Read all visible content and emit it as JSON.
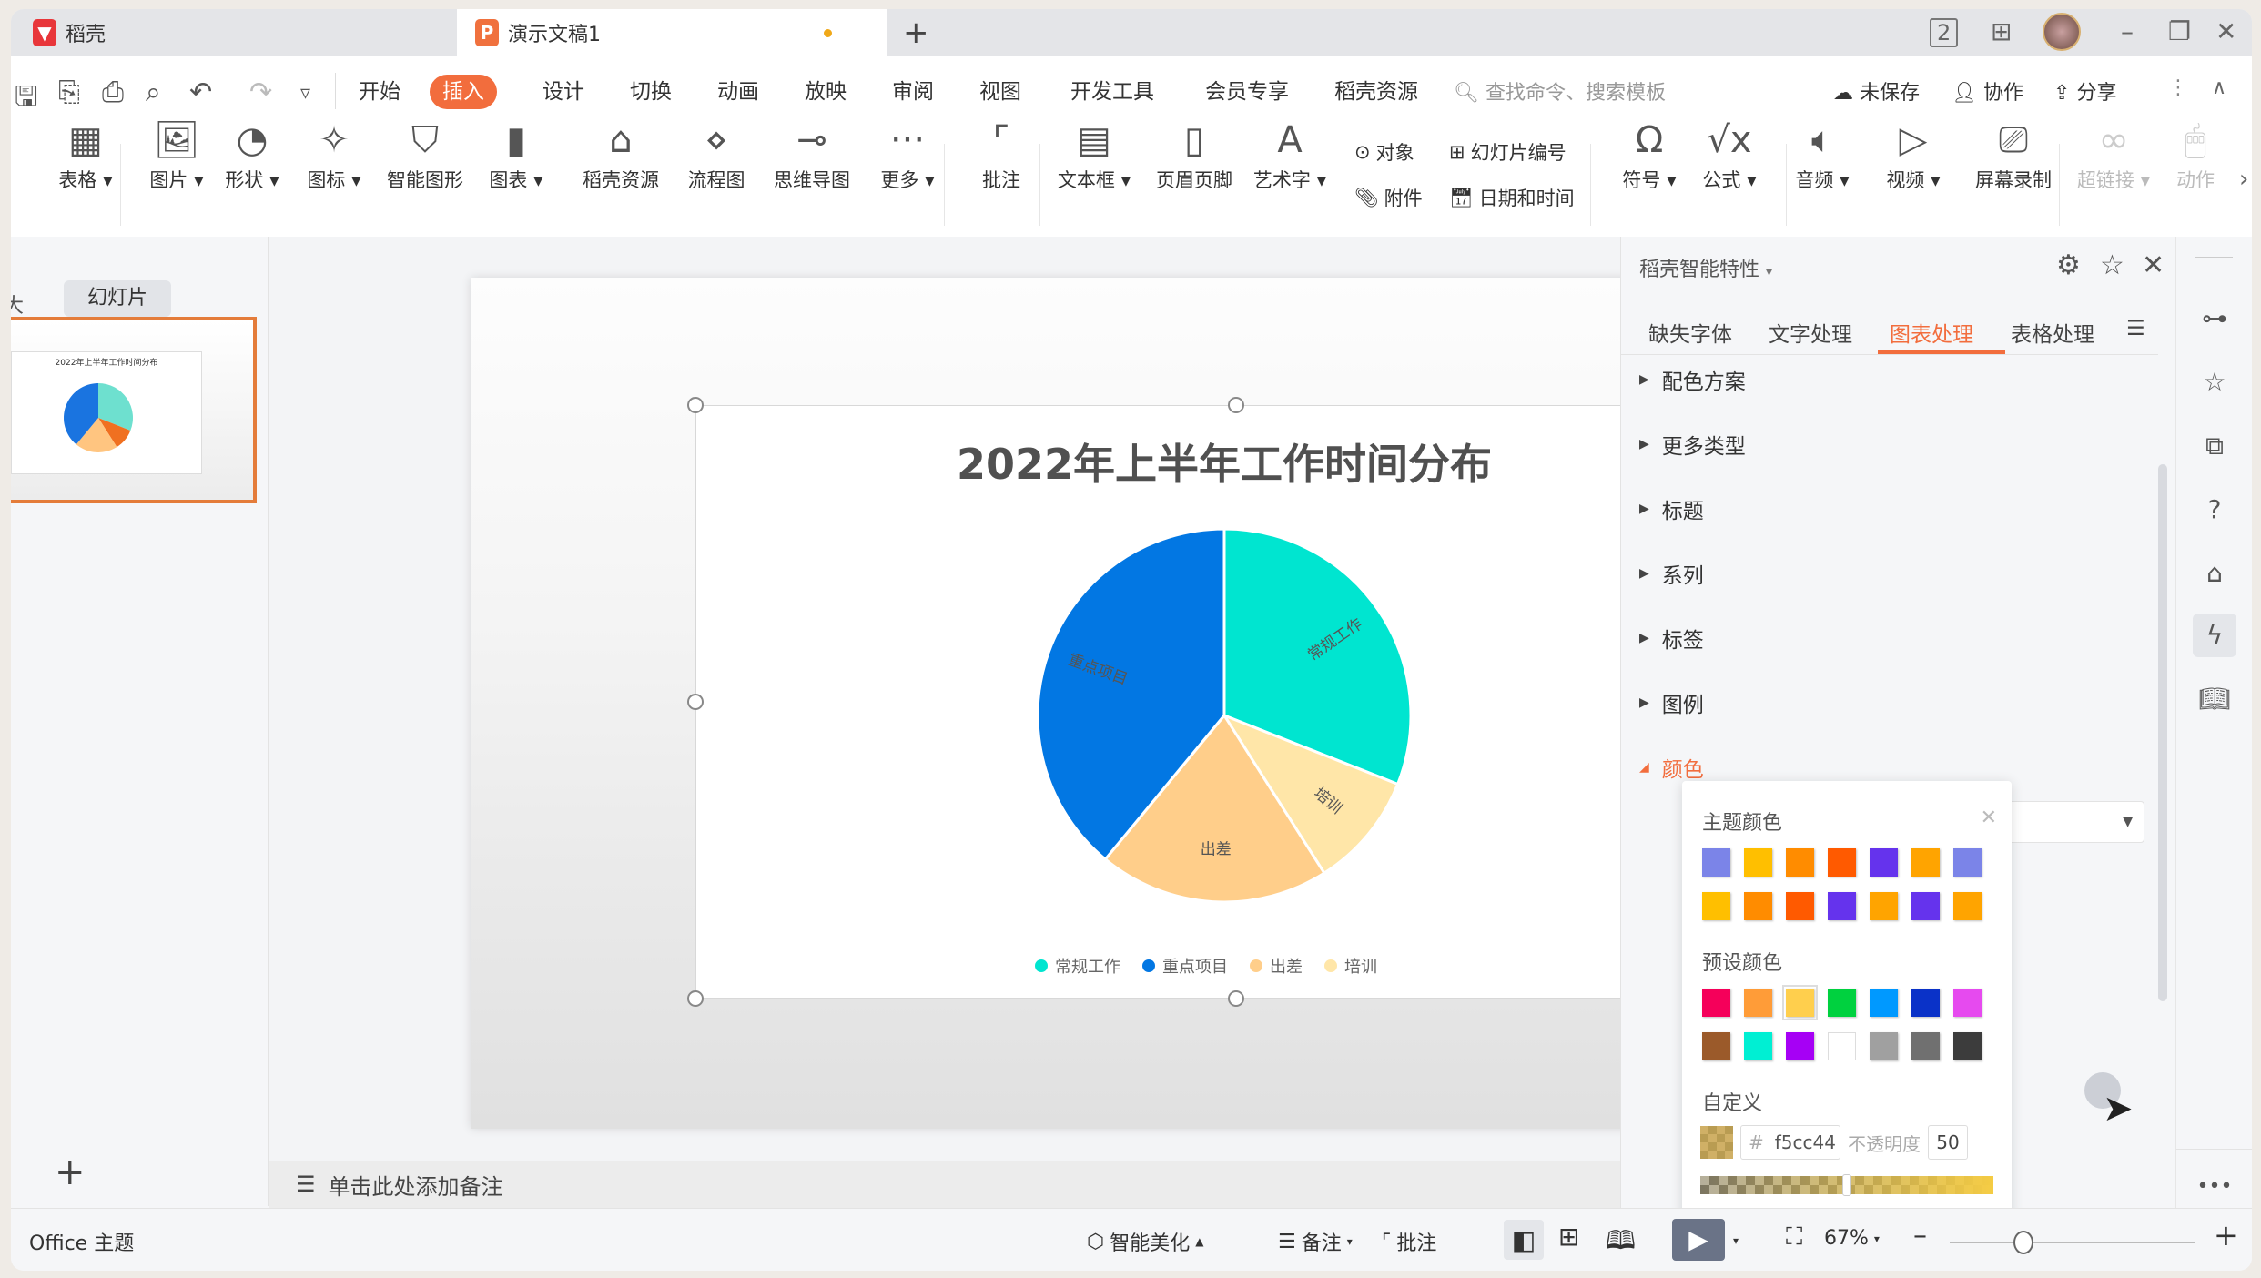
{
  "tabs": [
    {
      "label": "稻壳",
      "icon": "docer-logo-icon",
      "color": "#e8363a"
    },
    {
      "label": "演示文稿1",
      "icon": "presentation-file-icon",
      "color": "#f0713e",
      "unsaved": true
    }
  ],
  "window_controls": {
    "badge": "2",
    "new_tab": "+",
    "minimize": "–",
    "restore": "❐",
    "close": "✕"
  },
  "menu": {
    "items": [
      "开始",
      "插入",
      "设计",
      "切换",
      "动画",
      "放映",
      "审阅",
      "视图",
      "开发工具",
      "会员专享",
      "稻壳资源"
    ],
    "active": "插入",
    "search_placeholder": "查找命令、搜索模板",
    "unsaved": "未保存",
    "collaborate": "协作",
    "share": "分享"
  },
  "ribbon": {
    "buttons": [
      {
        "label": "表格",
        "icon": "table-icon",
        "dropdown": true
      },
      {
        "label": "图片",
        "icon": "image-icon",
        "dropdown": true
      },
      {
        "label": "形状",
        "icon": "shape-icon",
        "dropdown": true
      },
      {
        "label": "图标",
        "icon": "icons-icon",
        "dropdown": true
      },
      {
        "label": "智能图形",
        "icon": "smartart-icon"
      },
      {
        "label": "图表",
        "icon": "chart-icon",
        "dropdown": true
      },
      {
        "label": "稻壳资源",
        "icon": "docer-resource-icon"
      },
      {
        "label": "流程图",
        "icon": "flowchart-icon"
      },
      {
        "label": "思维导图",
        "icon": "mindmap-icon"
      },
      {
        "label": "更多",
        "icon": "more-icon",
        "dropdown": true
      },
      {
        "label": "批注",
        "icon": "comment-icon"
      },
      {
        "label": "文本框",
        "icon": "textbox-icon",
        "dropdown": true
      },
      {
        "label": "页眉页脚",
        "icon": "header-footer-icon"
      },
      {
        "label": "艺术字",
        "icon": "wordart-icon",
        "dropdown": true
      },
      {
        "label": "符号",
        "icon": "symbol-icon",
        "dropdown": true
      },
      {
        "label": "公式",
        "icon": "formula-icon",
        "dropdown": true
      },
      {
        "label": "音频",
        "icon": "audio-icon",
        "dropdown": true
      },
      {
        "label": "视频",
        "icon": "video-icon",
        "dropdown": true
      },
      {
        "label": "屏幕录制",
        "icon": "screen-record-icon"
      },
      {
        "label": "超链接",
        "icon": "hyperlink-icon",
        "dropdown": true,
        "disabled": true
      },
      {
        "label": "动作",
        "icon": "action-icon",
        "disabled": true
      }
    ],
    "small": {
      "object": "对象",
      "attachment": "附件",
      "slide_number": "幻灯片编号",
      "date_time": "日期和时间"
    }
  },
  "left_panel": {
    "outline_tab": "大纲",
    "slides_tab": "幻灯片",
    "add": "+"
  },
  "chart_data": {
    "type": "pie",
    "title": "2022年上半年工作时间分布",
    "categories": [
      "常规工作",
      "培训",
      "出差",
      "重点项目"
    ],
    "values": [
      31,
      10,
      20,
      39
    ],
    "unit": "percent (estimated from slice angles)",
    "colors": [
      "#00e5d0",
      "#ffe6a8",
      "#ffce8a",
      "#0277e3"
    ],
    "legend": {
      "position": "bottom",
      "entries": [
        "常规工作",
        "重点项目",
        "出差",
        "培训"
      ],
      "colors": [
        "#00e5d0",
        "#0277e3",
        "#ffce8a",
        "#ffe6a8"
      ]
    },
    "data_labels": [
      "常规工作",
      "培训",
      "出差",
      "重点项目"
    ]
  },
  "thumbnail": {
    "title": "2022年上半年工作时间分布",
    "colors": [
      "#6ee0cf",
      "#f07020",
      "#ffc580",
      "#1a74e0"
    ]
  },
  "notes": {
    "placeholder": "单击此处添加备注"
  },
  "right_panel": {
    "title": "稻壳智能特性",
    "tabs": [
      "缺失字体",
      "文字处理",
      "图表处理",
      "表格处理"
    ],
    "active_tab": "图表处理",
    "sections": [
      "配色方案",
      "更多类型",
      "标题",
      "系列",
      "标签",
      "图例",
      "颜色"
    ],
    "open_section": "颜色"
  },
  "color_popup": {
    "theme_label": "主题颜色",
    "theme_colors": [
      [
        "#7b84e8",
        "#ffbf00",
        "#ff8c00",
        "#ff5a00",
        "#6533ed",
        "#ffa400",
        "#7b84e8"
      ],
      [
        "#ffbf00",
        "#ff8c00",
        "#ff5a00",
        "#6533ed",
        "#ffa400",
        "#6533ed",
        "#ffa400"
      ]
    ],
    "preset_label": "预设颜色",
    "preset_colors": [
      [
        "#f5005a",
        "#ff9c38",
        "#ffcf4d",
        "#00d13f",
        "#0099ff",
        "#0a32c8",
        "#e64aef"
      ],
      [
        "#9b5a2a",
        "#00efd3",
        "#a600f5",
        "#ffffff",
        "#a0a0a0",
        "#707070",
        "#3c3c3c"
      ]
    ],
    "selected_preset": "#ffcf4d",
    "custom_label": "自定义",
    "hex_value": "f5cc44",
    "opacity_label": "不透明度",
    "opacity_value": "50",
    "opacity_fraction": 0.5
  },
  "status_bar": {
    "theme": "Office 主题",
    "smart_beautify": "智能美化",
    "notes": "备注",
    "comments": "批注",
    "zoom": "67%",
    "zoom_fraction": 0.3
  }
}
